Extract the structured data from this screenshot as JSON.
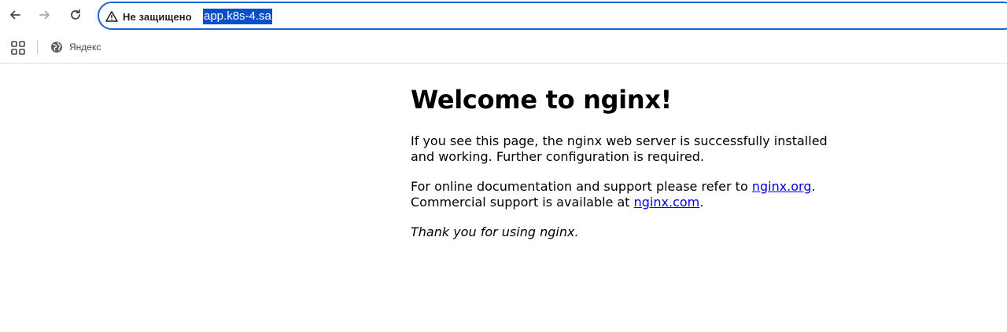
{
  "toolbar": {
    "back_icon": "arrow-left-icon",
    "forward_icon": "arrow-right-icon",
    "reload_icon": "reload-icon",
    "security_icon": "warning-triangle-icon",
    "security_label": "Не защищено",
    "url": "app.k8s-4.sa"
  },
  "bookmarks": {
    "apps_icon": "apps-grid-icon",
    "items": [
      {
        "icon": "globe-icon",
        "label": "Яндекс"
      }
    ]
  },
  "page": {
    "heading": "Welcome to nginx!",
    "para1": "If you see this page, the nginx web server is successfully installed and working. Further configuration is required.",
    "para2_prefix": "For online documentation and support please refer to ",
    "link_org": "nginx.org",
    "para2_mid": ".",
    "para2_line2": "Commercial support is available at ",
    "link_com": "nginx.com",
    "para2_end": ".",
    "thanks": "Thank you for using nginx."
  },
  "colors": {
    "omnibox_border": "#1a66d2",
    "url_selection": "#0a4ec9",
    "link": "#0000ee"
  }
}
